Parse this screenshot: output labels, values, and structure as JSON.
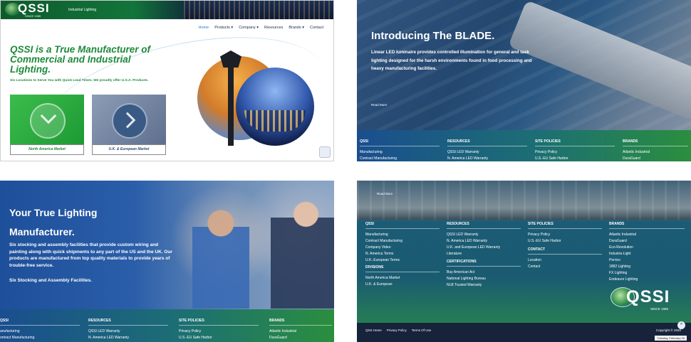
{
  "panel1": {
    "logo_text": "QSSI",
    "logo_since": "SINCE 1985",
    "logo_sub": "Industrial Lighting",
    "nav": [
      "Home",
      "Products ▾",
      "Company ▾",
      "Resources",
      "Brands ▾",
      "Contact"
    ],
    "headline": "QSSI is a True Manufacturer of Commercial and Industrial Lighting.",
    "subline": "Six Locations to Serve You with Quick Lead Times. We proudly offer U.S.A. Products.",
    "card_na": "North America Market",
    "card_uk": "U.K. & European Market"
  },
  "panel2": {
    "title": "Introducing The BLADE.",
    "desc": "Linear LED luminaire provides controlled illumination for general and task lighting designed for the harsh environments found in food processing and heavy manufacturing facilities.",
    "read_more": "Read More",
    "footer": [
      {
        "heading": "QSSI",
        "items": [
          "Manufacturing",
          "Contract Manufacturing"
        ]
      },
      {
        "heading": "RESOURCES",
        "items": [
          "QSSI LED Warranty",
          "N. America LED Warranty"
        ]
      },
      {
        "heading": "SITE POLICIES",
        "items": [
          "Privacy Policy",
          "U.S.-EU Safe Harbor"
        ]
      },
      {
        "heading": "BRANDS",
        "items": [
          "Atlantic Industrial",
          "DuraGuard"
        ]
      }
    ]
  },
  "panel3": {
    "title_line1": "Your True Lighting",
    "title_line2": "Manufacturer.",
    "desc": "Six stocking and assembly facilities that provide custom wiring and painting along with quick shipments to any part of the US and the UK. Our products are manufactured from top quality materials to provide years of trouble-free service.",
    "tagline": "Six Stocking and Assembly Facilities.",
    "footer": [
      {
        "heading": "QSSI",
        "items": [
          "anufacturing",
          "ontract Manufacturing"
        ]
      },
      {
        "heading": "RESOURCES",
        "items": [
          "QSSI LED Warranty",
          "N. America LED Warranty"
        ]
      },
      {
        "heading": "SITE POLICIES",
        "items": [
          "Privacy Policy",
          "U.S.-EU Safe Harbor"
        ]
      },
      {
        "heading": "BRANDS",
        "items": [
          "Atlantic Industrial",
          "DuraGuard"
        ]
      }
    ]
  },
  "panel4": {
    "read_more": "Read More",
    "col_qssi": {
      "heading": "QSSI",
      "items": [
        "Manufacturing",
        "Contract Manufacturing",
        "Company Video",
        "N. America Terms",
        "U.K.-European Terms"
      ]
    },
    "col_divisions": {
      "heading": "DIVISIONS",
      "items": [
        "North America Market",
        "U.K. & European"
      ]
    },
    "col_resources": {
      "heading": "RESOURCES",
      "items": [
        "QSSI LED Warranty",
        "N. America LED Warranty",
        "U.K. and European LED Warranty",
        "Literature"
      ]
    },
    "col_cert": {
      "heading": "CERTIFICATIONS",
      "items": [
        "Buy American Act",
        "National Lighting Bureau",
        "NLB Trusted Warranty"
      ]
    },
    "col_policies": {
      "heading": "SITE POLICIES",
      "items": [
        "Privacy Policy",
        "U.S.-EU Safe Harbor"
      ]
    },
    "col_contact": {
      "heading": "CONTACT",
      "items": [
        "Location",
        "Contact"
      ]
    },
    "col_brands": {
      "heading": "BRANDS",
      "items": [
        "Atlantic Industrial",
        "DuraGuard",
        "Eco-Revolution",
        "Industra-Light",
        "Perrico",
        "1882 Lighting",
        "FX Lighting",
        "Endeavor Lighting"
      ]
    },
    "logo_text": "QSSI",
    "logo_since": "SINCE 1985",
    "bottom_links": [
      "QSS Home",
      "Privacy Policy",
      "Terms Of Use"
    ],
    "copyright": "Copyright © 2020",
    "date": "Tuesday, February 25",
    "up_arrow": "^"
  }
}
